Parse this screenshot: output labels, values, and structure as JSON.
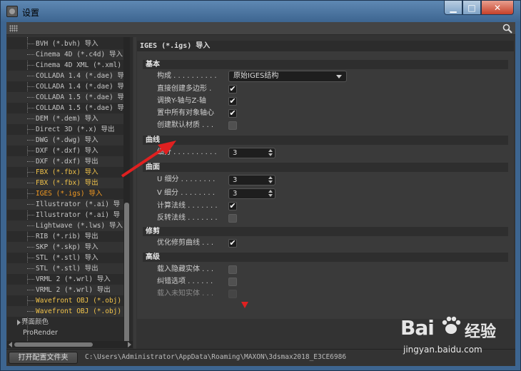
{
  "window": {
    "title": "设置"
  },
  "tree": {
    "items": [
      {
        "label": "BVH (*.bvh) 导入",
        "color": "normal"
      },
      {
        "label": "Cinema 4D (*.c4d) 导入",
        "color": "normal"
      },
      {
        "label": "Cinema 4D XML (*.xml)",
        "color": "normal"
      },
      {
        "label": "COLLADA 1.4 (*.dae) 导",
        "color": "normal"
      },
      {
        "label": "COLLADA 1.4 (*.dae) 导",
        "color": "normal"
      },
      {
        "label": "COLLADA 1.5 (*.dae) 导",
        "color": "normal"
      },
      {
        "label": "COLLADA 1.5 (*.dae) 导",
        "color": "normal"
      },
      {
        "label": "DEM (*.dem) 导入",
        "color": "normal"
      },
      {
        "label": "Direct 3D (*.x) 导出",
        "color": "normal"
      },
      {
        "label": "DWG (*.dwg) 导入",
        "color": "normal"
      },
      {
        "label": "DXF (*.dxf) 导入",
        "color": "normal"
      },
      {
        "label": "DXF (*.dxf) 导出",
        "color": "normal"
      },
      {
        "label": "FBX (*.fbx) 导入",
        "color": "yellow"
      },
      {
        "label": "FBX (*.fbx) 导出",
        "color": "yellow"
      },
      {
        "label": "IGES (*.igs) 导入",
        "color": "orange"
      },
      {
        "label": "Illustrator (*.ai) 导",
        "color": "normal"
      },
      {
        "label": "Illustrator (*.ai) 导",
        "color": "normal"
      },
      {
        "label": "Lightwave (*.lws) 导入",
        "color": "normal"
      },
      {
        "label": "RIB (*.rib) 导出",
        "color": "normal"
      },
      {
        "label": "SKP (*.skp) 导入",
        "color": "normal"
      },
      {
        "label": "STL (*.stl) 导入",
        "color": "normal"
      },
      {
        "label": "STL (*.stl) 导出",
        "color": "normal"
      },
      {
        "label": "VRML 2 (*.wrl) 导入",
        "color": "normal"
      },
      {
        "label": "VRML 2 (*.wrl) 导出",
        "color": "normal"
      },
      {
        "label": "Wavefront OBJ (*.obj)",
        "color": "yellow"
      },
      {
        "label": "Wavefront OBJ (*.obj)",
        "color": "yellow"
      }
    ],
    "bottom_items": [
      "界面颜色",
      "ProRender"
    ]
  },
  "panel": {
    "title": "IGES (*.igs) 导入",
    "sections": {
      "basic": "基本",
      "curve": "曲线",
      "surface": "曲面",
      "trim": "修剪",
      "advanced": "高级"
    },
    "basic": {
      "structure_label": "构成 . . . . . . . . . .",
      "structure_value": "原始IGES结构",
      "create_polygons_label": "直接创建多边形 .",
      "create_polygons_checked": "✔",
      "swap_axes_label": "调换Y-轴与Z-轴",
      "swap_axes_checked": "✔",
      "center_axes_label": "置中所有对象轴心",
      "center_axes_checked": "✔",
      "default_material_label": "创建默认材质 . . .",
      "default_material_checked": ""
    },
    "curve": {
      "subdiv_label": "细分 . . . . . . . . . .",
      "subdiv_value": "3"
    },
    "surface": {
      "u_label": "U 细分 . . . . . . . .",
      "u_value": "3",
      "v_label": "V 细分 . . . . . . . .",
      "v_value": "3",
      "normals_label": "计算法线 . . . . . . .",
      "normals_checked": "✔",
      "reverse_label": "反转法线 . . . . . . .",
      "reverse_checked": ""
    },
    "trim": {
      "optimize_label": "优化修剪曲线 . . .",
      "optimize_checked": "✔"
    },
    "advanced": {
      "hidden_label": "载入隐藏实体 . . .",
      "errors_label": "纠错选项 . . . . . .",
      "unknown_label": "载入未知实体 . . ."
    }
  },
  "footer": {
    "open_folder_button": "打开配置文件夹",
    "path": "C:\\Users\\Administrator\\AppData\\Roaming\\MAXON\\3dsmax2018_E3CE6986"
  },
  "watermark": {
    "logo": "Bai",
    "logo2": "经验",
    "url": "jingyan.baidu.com"
  }
}
